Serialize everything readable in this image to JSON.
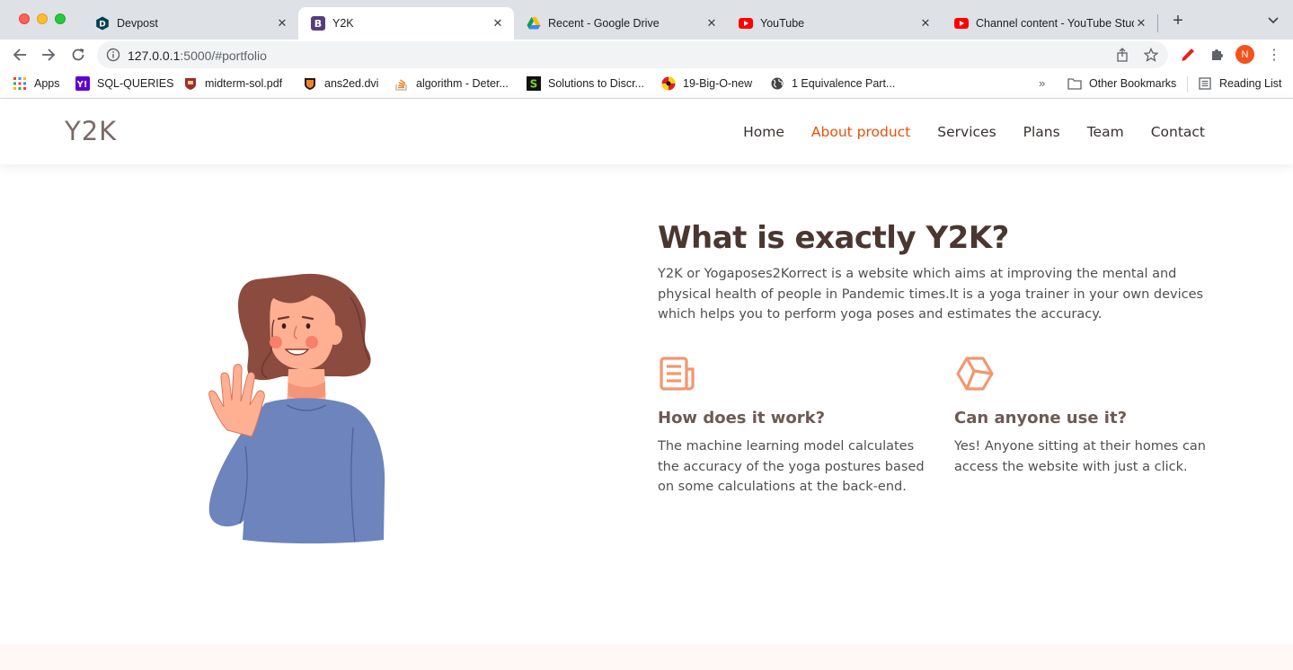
{
  "browser": {
    "tabs": [
      {
        "title": "Devpost",
        "icon": "devpost-icon"
      },
      {
        "title": "Y2K",
        "icon": "bootstrap-icon"
      },
      {
        "title": "Recent - Google Drive",
        "icon": "google-drive-icon"
      },
      {
        "title": "YouTube",
        "icon": "youtube-icon"
      },
      {
        "title": "Channel content - YouTube Studio",
        "icon": "youtube-icon"
      }
    ],
    "url_host": "127.0.0.1",
    "url_rest": ":5000/#portfolio",
    "avatar_letter": "N",
    "bookmarks": [
      {
        "label": "Apps"
      },
      {
        "label": "SQL-QUERIES"
      },
      {
        "label": "midterm-sol.pdf"
      },
      {
        "label": "ans2ed.dvi"
      },
      {
        "label": "algorithm - Deter..."
      },
      {
        "label": "Solutions to Discr..."
      },
      {
        "label": "19-Big-O-new"
      },
      {
        "label": "1 Equivalence Part..."
      }
    ],
    "bookmarks_more": "»",
    "other_bookmarks": "Other Bookmarks",
    "reading_list": "Reading List"
  },
  "site": {
    "logo": "Y2K",
    "nav": [
      {
        "label": "Home"
      },
      {
        "label": "About product"
      },
      {
        "label": "Services"
      },
      {
        "label": "Plans"
      },
      {
        "label": "Team"
      },
      {
        "label": "Contact"
      }
    ],
    "active_nav": "About product",
    "accent_color": "#e84f0c",
    "icon_color": "#f4966d"
  },
  "about": {
    "title": "What is exactly Y2K?",
    "description": "Y2K or Yogaposes2Korrect is a website which aims at improving the mental and physical health of people in Pandemic times.It is a yoga trainer in your own devices which helps you to perform yoga poses and estimates the accuracy.",
    "features": [
      {
        "icon": "newspaper-icon",
        "title": "How does it work?",
        "text": "The machine learning model calculates the accuracy of the yoga postures based on some calculations at the back-end."
      },
      {
        "icon": "cube-icon",
        "title": "Can anyone use it?",
        "text": "Yes! Anyone sitting at their homes can access the website with just a click."
      }
    ]
  }
}
